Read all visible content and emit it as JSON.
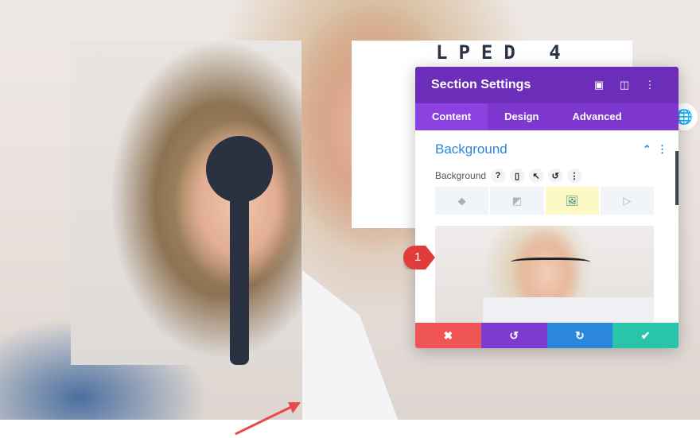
{
  "eye_chart": {
    "letters": "LPED",
    "number": "4"
  },
  "panel": {
    "title": "Section Settings",
    "header_icons": [
      "fullscreen-icon",
      "split-view-icon",
      "more-icon"
    ],
    "tabs": [
      {
        "label": "Content",
        "active": true
      },
      {
        "label": "Design",
        "active": false
      },
      {
        "label": "Advanced",
        "active": false
      }
    ],
    "section_title": "Background",
    "field_label": "Background",
    "field_icons": [
      "help-icon",
      "responsive-icon",
      "hover-icon",
      "reset-icon",
      "more-icon"
    ],
    "bg_types": [
      {
        "name": "color",
        "selected": false
      },
      {
        "name": "gradient",
        "selected": false
      },
      {
        "name": "image",
        "selected": true
      },
      {
        "name": "video",
        "selected": false
      }
    ],
    "footer": [
      {
        "name": "cancel",
        "color": "#ef5555"
      },
      {
        "name": "undo",
        "color": "#7e3bd0"
      },
      {
        "name": "redo",
        "color": "#2b87da"
      },
      {
        "name": "save",
        "color": "#29c4a9"
      }
    ]
  },
  "badge": "1",
  "colors": {
    "header": "#6c2eb9",
    "tabs": "#7e37cf",
    "accent": "#2b87da",
    "badge": "#e23b3b",
    "arrow": "#e84a4a"
  }
}
